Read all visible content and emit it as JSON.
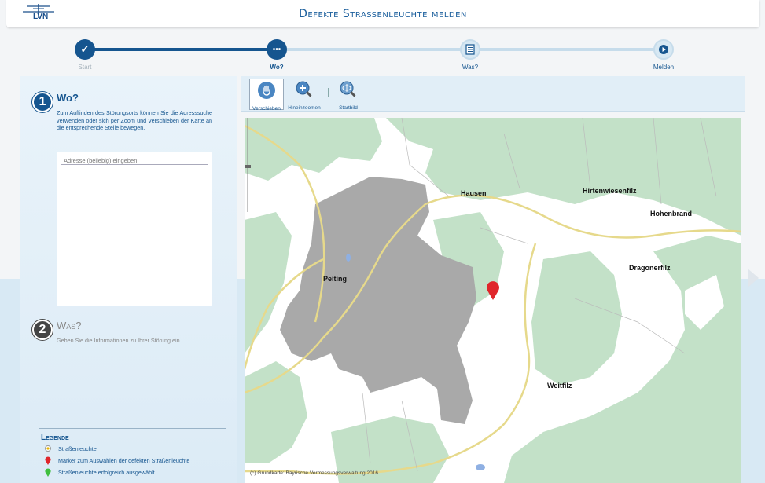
{
  "header": {
    "logo_text": "LVN",
    "title": "Defekte Straßenleuchte melden"
  },
  "stepper": {
    "steps": [
      {
        "label": "Start",
        "state": "done",
        "symbol": "✓"
      },
      {
        "label": "Wo?",
        "state": "active",
        "symbol": "..."
      },
      {
        "label": "Was?",
        "state": "future",
        "symbol": "list-icon"
      },
      {
        "label": "Melden",
        "state": "future",
        "symbol": "play-icon"
      }
    ]
  },
  "left_panel": {
    "section1": {
      "number": "1",
      "title": "Wo?",
      "text": "Zum Auffinden des Störungsorts können Sie die Adresssuche verwenden oder sich per Zoom und Verschieben der Karte an die entsprechende Stelle bewegen.",
      "address_placeholder": "Adresse (beliebig) eingeben"
    },
    "section2": {
      "number": "2",
      "title": "Was?",
      "text": "Geben Sie die Informationen zu Ihrer Störung ein."
    },
    "legend": {
      "title": "Legende",
      "items": [
        {
          "label": "Straßenleuchte",
          "icon": "streetlight-icon"
        },
        {
          "label": "Marker zum Auswählen der defekten Straßenleuchte",
          "icon": "red-marker-icon"
        },
        {
          "label": "Straßenleuchte erfolgreich ausgewählt",
          "icon": "green-marker-icon"
        }
      ]
    }
  },
  "toolbar": {
    "tools": [
      {
        "label": "Verschieben",
        "icon": "hand-icon",
        "active": true
      },
      {
        "label": "Hineinzoomen",
        "icon": "zoom-in-icon",
        "active": false
      },
      {
        "label": "Startbild",
        "icon": "home-view-icon",
        "active": false
      }
    ]
  },
  "map": {
    "places": [
      "Hausen",
      "Hirtenwiesenfilz",
      "Hohenbrand",
      "Peiting",
      "Dragonerfilz",
      "Weitfilz"
    ],
    "credit": "(c) Grundkarte: Bayrische Vermessungsverwaltung 2016",
    "colors": {
      "forest": "#c3e1c8",
      "town": "#a9a9a9",
      "road": "#f2e7a8",
      "marker": "#e0262b"
    }
  }
}
